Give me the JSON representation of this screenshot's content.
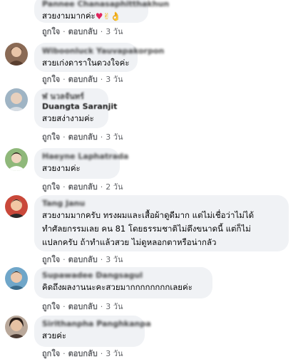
{
  "actions": {
    "like": "ถูกใจ",
    "reply": "ตอบกลับ",
    "dot": "·"
  },
  "comments": [
    {
      "author": "Pannee Chanasaphitthakhun",
      "text": "สวยงามมากค่ะ",
      "time": "3 วัน",
      "emoji": [
        "heart-emoji",
        "victory-hand-emoji",
        "ok-hand-emoji"
      ]
    },
    {
      "author": "Wiboonluck Yauvapakorpon",
      "text": "สวยเก่งดาราในดวงใจค่ะ",
      "time": "3 วัน"
    },
    {
      "author_line1": "ฬ นวลจันทร์",
      "author": "Duangta Saranjit",
      "text": "สวยสง่างามค่ะ",
      "time": "3 วัน"
    },
    {
      "author": "Haeyne Laphatrada",
      "text": "สวยงามค่ะ",
      "time": "2 วัน"
    },
    {
      "author": "Tang Janu",
      "text": "สวยงามมากครับ ทรงผมและเสื้อผ้าดูดีมาก แต่ไม่เชื่อว่าไม่ได้\nทำศัลยกรรมเลย คน 81 โดยธรรมชาติไม่ตึงขนาดนี้ แต่ก็ไม่\nแปลกครับ ถ้าทำแล้วสวย ไม่ดูหลอกตาหรือน่ากลัว",
      "time": "3 วัน"
    },
    {
      "author": "Supawadee Dangsagul",
      "text": "คิดถึงผลงานนะคะสวยมากกกกกกกกเลยค่ะ",
      "time": "3 วัน"
    },
    {
      "author": "Sirithanpha Panghkanpa",
      "text": "สวยค่ะ",
      "time": "3 วัน"
    }
  ],
  "colors": {
    "bubble": "#f0f2f5",
    "meta": "#65676b",
    "text": "#050505"
  }
}
